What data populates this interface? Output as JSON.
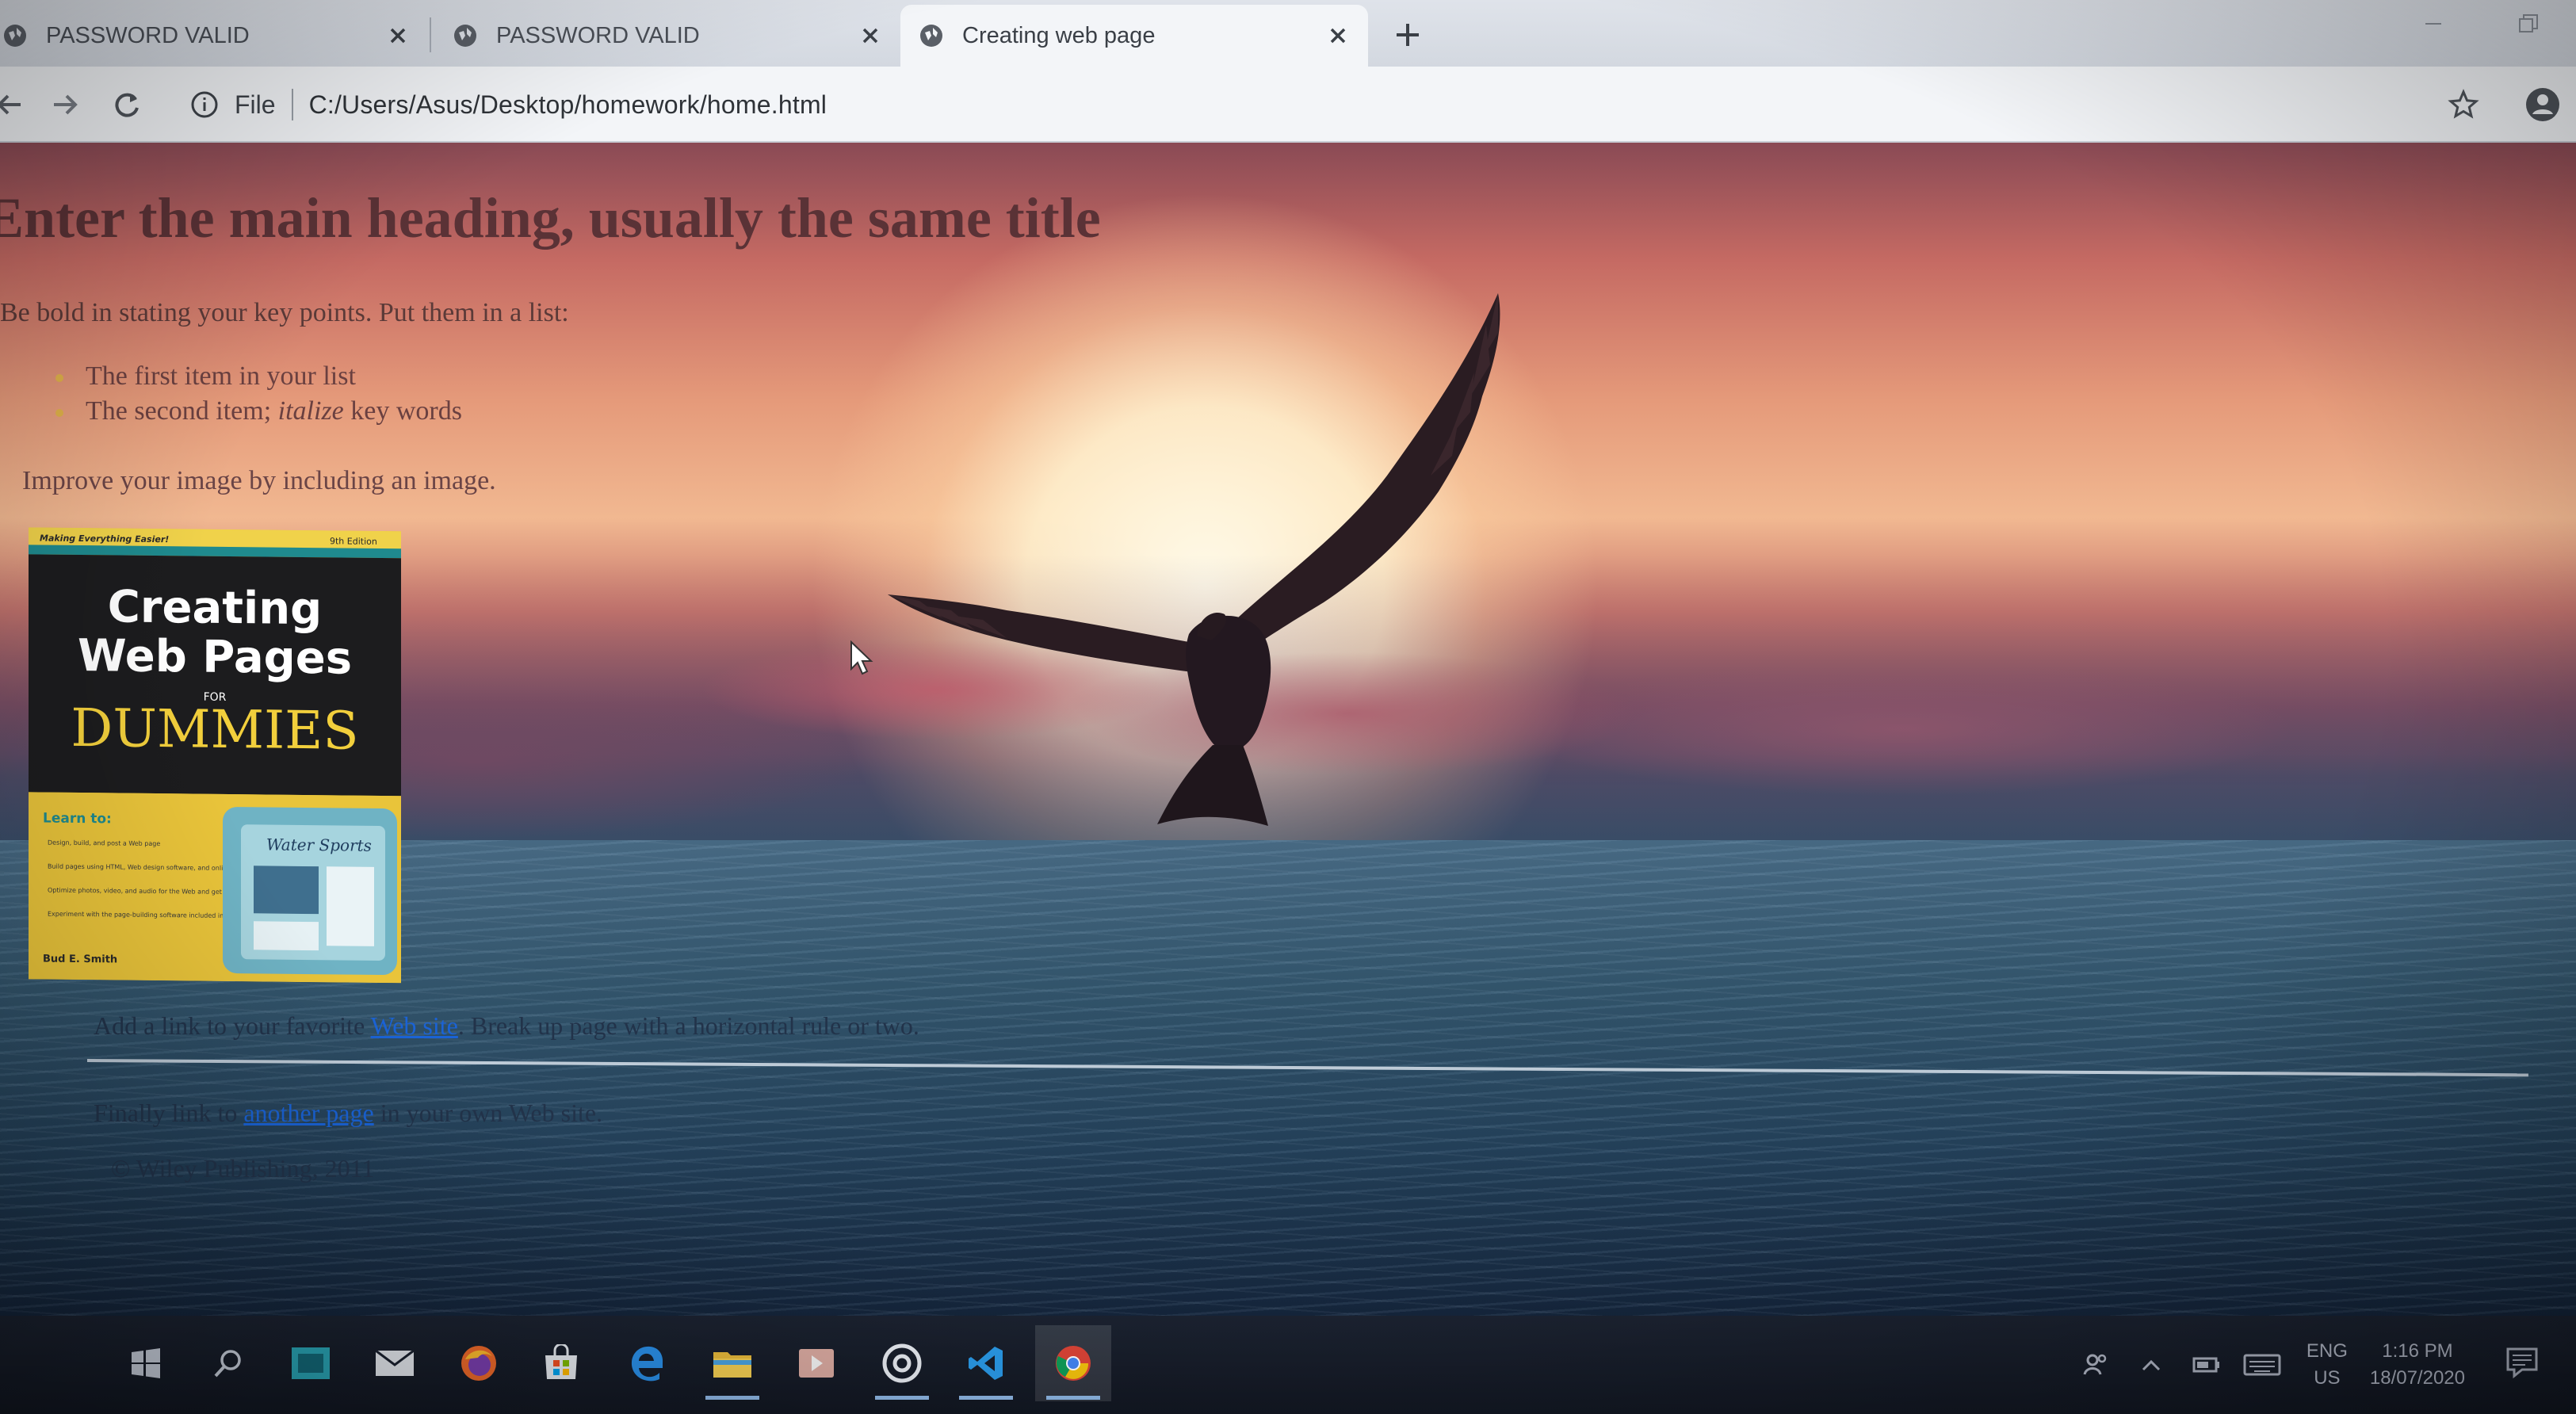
{
  "browser": {
    "tabs": [
      {
        "title": "PASSWORD VALID",
        "active": false
      },
      {
        "title": "PASSWORD VALID",
        "active": false
      },
      {
        "title": "Creating web page",
        "active": true
      }
    ],
    "omnibox": {
      "scheme_label": "File",
      "url": "C:/Users/Asus/Desktop/homework/home.html"
    }
  },
  "page": {
    "heading": "Enter the main heading, usually the same title",
    "intro": "Be bold in stating your key points. Put them in a list:",
    "list": {
      "item1": "The first item in your list",
      "item2_prefix": "The second item; ",
      "item2_italic": "italize",
      "item2_suffix": " key words"
    },
    "improve": "Improve your image by including an image.",
    "book": {
      "tagline": "Making Everything Easier!",
      "edition": "9th Edition",
      "title_line1": "Creating",
      "title_line2": "Web Pages",
      "for": "FOR",
      "dummies": "DUMMIES",
      "learn_to": "Learn to:",
      "bullets": [
        "Design, build, and post a Web page",
        "Build pages using HTML, Web design software, and online tools",
        "Optimize photos, video, and audio for the Web and get them onto your page",
        "Experiment with the page-building software included in this book"
      ],
      "inset": "Water Sports",
      "author": "Bud E. Smith"
    },
    "link_line": {
      "prefix": "Add a link to your favorite ",
      "link": "Web site",
      "suffix": ". Break up page with a horizontal rule or two."
    },
    "other_line": {
      "prefix": "Finally link to ",
      "link": "another page",
      "suffix": " in your own Web site."
    },
    "footer": "© Wiley Publishing, 2011"
  },
  "taskbar": {
    "apps": [
      "start",
      "search",
      "task-view",
      "mail",
      "firefox",
      "store",
      "edge",
      "file-explorer",
      "media",
      "obs",
      "vscode",
      "chrome"
    ],
    "lang_top": "ENG",
    "lang_bottom": "US",
    "time": "1:16 PM",
    "date": "18/07/2020"
  },
  "colors": {
    "tab_strip": "#dfe3ea",
    "toolbar": "#f3f5f8",
    "heading": "#5a3236",
    "link": "#1a63d6",
    "taskbar": "#1b2230",
    "book_yellow": "#e9c43a"
  }
}
